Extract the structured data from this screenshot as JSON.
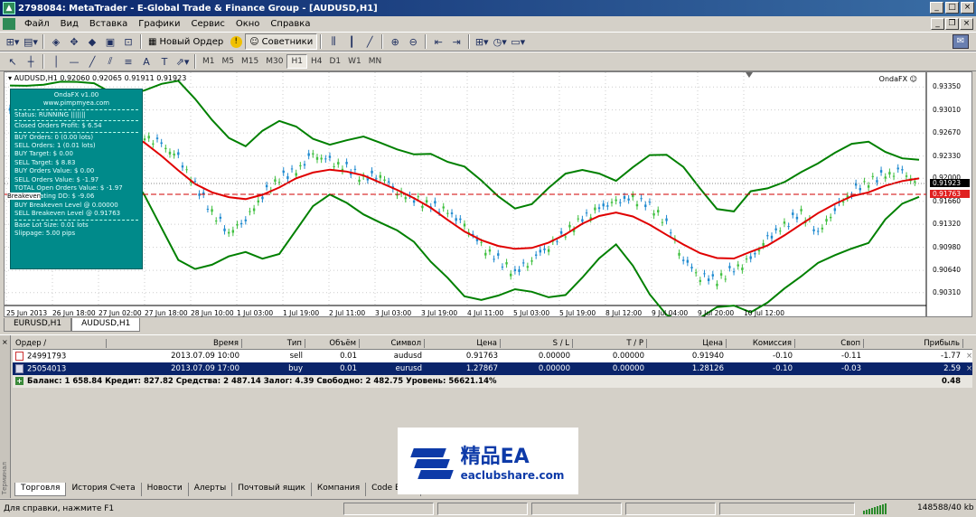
{
  "window": {
    "title": "2798084: MetaTrader - E-Global Trade & Finance Group - [AUDUSD,H1]",
    "app_icon": "metatrader-icon"
  },
  "menu": [
    "Файл",
    "Вид",
    "Вставка",
    "Графики",
    "Сервис",
    "Окно",
    "Справка"
  ],
  "toolbar": {
    "new_order": "Новый Ордер",
    "experts": "Советники",
    "timeframes": [
      "M1",
      "M5",
      "M15",
      "M30",
      "H1",
      "H4",
      "D1",
      "W1",
      "MN"
    ],
    "active_timeframe": "H1"
  },
  "chart": {
    "header": "AUDUSD,H1  0.92060 0.92065 0.91911 0.91923",
    "ea_name": "OndaFX",
    "y_ticks": [
      "0.93350",
      "0.93010",
      "0.92670",
      "0.92330",
      "0.92000",
      "0.91660",
      "0.91320",
      "0.90980",
      "0.90640",
      "0.90310"
    ],
    "current_price": "0.91923",
    "breakeven_price": "0.91763",
    "x_ticks": [
      "25 Jun 2013",
      "26 Jun 18:00",
      "27 Jun 02:00",
      "27 Jun 18:00",
      "28 Jun 10:00",
      "1 Jul 03:00",
      "1 Jul 19:00",
      "2 Jul 11:00",
      "3 Jul 03:00",
      "3 Jul 19:00",
      "4 Jul 11:00",
      "5 Jul 03:00",
      "5 Jul 19:00",
      "8 Jul 12:00",
      "9 Jul 04:00",
      "9 Jul 20:00",
      "10 Jul 12:00"
    ],
    "breakeven_label": "Breakeven"
  },
  "info_panel": {
    "name": "OndaFX v1.00",
    "site": "www.pimpmyea.com",
    "status": "Status: RUNNING |||||||",
    "closed_profit": "Closed Orders Profit: $ 6.54",
    "lines": [
      "BUY Orders: 0 (0.00 lots)",
      "SELL Orders: 1 (0.01 lots)",
      "BUY Target: $ 0.00",
      "SELL Target: $ 8.83",
      "BUY Orders Value: $ 0.00",
      "SELL Orders Value: $ -1.97",
      "TOTAL Open Orders Value: $ -1.97",
      "MAX Floating DD: $ -9.06",
      "BUY Breakeven Level @ 0.00000",
      "SELL Breakeven Level @ 0.91763"
    ],
    "footer": [
      "Base Lot Size: 0.01 lots",
      "Slippage: 5.00 pips"
    ]
  },
  "chart_tabs": [
    "EURUSD,H1",
    "AUDUSD,H1"
  ],
  "active_chart_tab": "AUDUSD,H1",
  "terminal": {
    "side_label": "Терминал",
    "columns": [
      "Ордер",
      "Время",
      "Тип",
      "Объём",
      "Символ",
      "Цена",
      "S / L",
      "T / P",
      "Цена",
      "Комиссия",
      "Своп",
      "Прибыль"
    ],
    "rows": [
      {
        "order": "24991793",
        "time": "2013.07.09 10:00",
        "type": "sell",
        "volume": "0.01",
        "symbol": "audusd",
        "price": "0.91763",
        "sl": "0.00000",
        "tp": "0.00000",
        "current": "0.91940",
        "commission": "-0.10",
        "swap": "-0.11",
        "profit": "-1.77"
      },
      {
        "order": "25054013",
        "time": "2013.07.09 17:00",
        "type": "buy",
        "volume": "0.01",
        "symbol": "eurusd",
        "price": "1.27867",
        "sl": "0.00000",
        "tp": "0.00000",
        "current": "1.28126",
        "commission": "-0.10",
        "swap": "-0.03",
        "profit": "2.59"
      }
    ],
    "balance_line": "Баланс: 1 658.84  Кредит: 827.82  Средства: 2 487.14  Залог: 4.39  Свободно: 2 482.75  Уровень: 56621.14%",
    "balance_profit": "0.48",
    "tabs": [
      "Торговля",
      "История Счета",
      "Новости",
      "Алерты",
      "Почтовый ящик",
      "Компания",
      "Code Base"
    ],
    "active_tab": "Торговля"
  },
  "watermark": {
    "title": "精品EA",
    "url": "eaclubshare.com"
  },
  "status": {
    "help": "Для справки, нажмите F1",
    "memory": "148588/40 kb"
  },
  "colors": {
    "band": "#008000",
    "ma": "#e00000",
    "candle": "#1e8ad0",
    "bull": "#40c040",
    "panel": "#008a8a"
  }
}
